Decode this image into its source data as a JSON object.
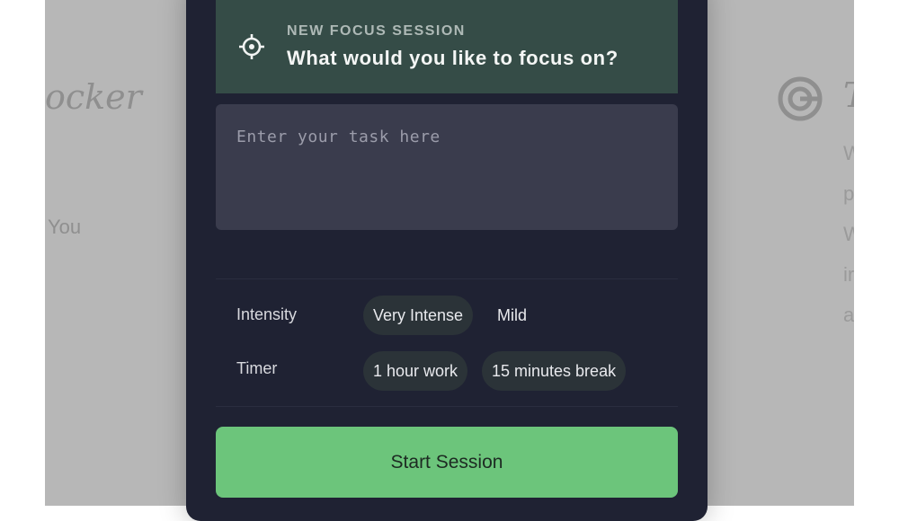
{
  "background": {
    "left_title_fragment": "ocker",
    "left_text_fragment": "You",
    "right_title_fragment": "T",
    "right_text_fragments": [
      "W",
      "p",
      "W",
      "ir",
      "a"
    ]
  },
  "modal": {
    "header": {
      "icon": "target-icon",
      "kicker": "NEW FOCUS SESSION",
      "question": "What would you like to focus on?"
    },
    "task_input": {
      "placeholder": "Enter your task here",
      "value": ""
    },
    "intensity": {
      "label": "Intensity",
      "options": [
        {
          "label": "Very Intense",
          "selected": true
        },
        {
          "label": "Mild",
          "selected": false
        }
      ]
    },
    "timer": {
      "label": "Timer",
      "options": [
        {
          "label": "1 hour work",
          "selected": true
        },
        {
          "label": "15 minutes break",
          "selected": true
        }
      ]
    },
    "start_button_label": "Start Session"
  },
  "colors": {
    "header_bg": "#354c47",
    "modal_bg": "#1f2233",
    "accent_green": "#6cc57b"
  }
}
